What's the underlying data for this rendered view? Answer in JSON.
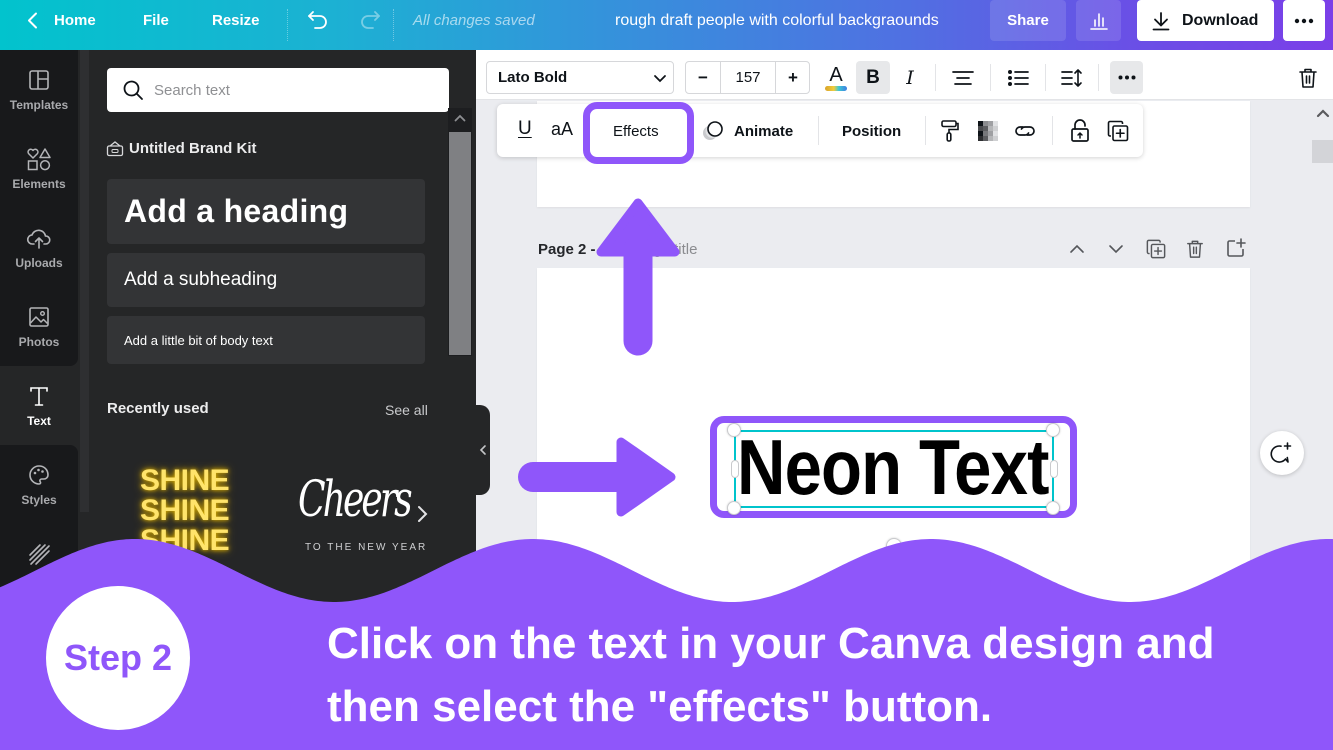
{
  "topbar": {
    "home": "Home",
    "file": "File",
    "resize": "Resize",
    "save_status": "All changes saved",
    "doc_title": "rough draft people with colorful backgraounds",
    "share": "Share",
    "download": "Download"
  },
  "sidebar": {
    "items": [
      {
        "label": "Templates",
        "icon": "templates-icon"
      },
      {
        "label": "Elements",
        "icon": "elements-icon"
      },
      {
        "label": "Uploads",
        "icon": "uploads-icon"
      },
      {
        "label": "Photos",
        "icon": "photos-icon"
      },
      {
        "label": "Text",
        "icon": "text-icon",
        "active": true
      },
      {
        "label": "Styles",
        "icon": "styles-icon"
      },
      {
        "label": "",
        "icon": "background-pattern-icon"
      }
    ]
  },
  "panel": {
    "search_placeholder": "Search text",
    "brand_kit": "Untitled Brand Kit",
    "add_heading": "Add a heading",
    "add_subheading": "Add a subheading",
    "add_body": "Add a little bit of body text",
    "recent_title": "Recently used",
    "see_all": "See all",
    "recent": [
      {
        "name": "shine-neon",
        "lines": [
          "SHINE",
          "SHINE",
          "SHINE"
        ]
      },
      {
        "name": "cheers",
        "script": "Cheers",
        "caption": "TO THE NEW YEAR"
      }
    ]
  },
  "toolbar": {
    "font": "Lato Bold",
    "font_size": "157",
    "minus": "−",
    "plus": "+",
    "color_glyph": "A",
    "bold_glyph": "B",
    "italic_glyph": "I"
  },
  "floating_toolbar": {
    "underline_glyph": "U",
    "case_glyph": "aA",
    "effects": "Effects",
    "animate": "Animate",
    "position": "Position"
  },
  "page2": {
    "label": "Page 2 -",
    "title_placeholder": "Add page title"
  },
  "canvas": {
    "text": "Neon Text"
  },
  "tutorial": {
    "step": "Step 2",
    "line1": "Click on the text in your Canva design and",
    "line2": "then select the \"effects\" button."
  },
  "colors": {
    "accent": "#8f56fa",
    "gradient_start": "#02c3cd",
    "gradient_end": "#7b3fe8",
    "selection": "#00c4cc",
    "neon_yellow": "#ffe46b"
  }
}
